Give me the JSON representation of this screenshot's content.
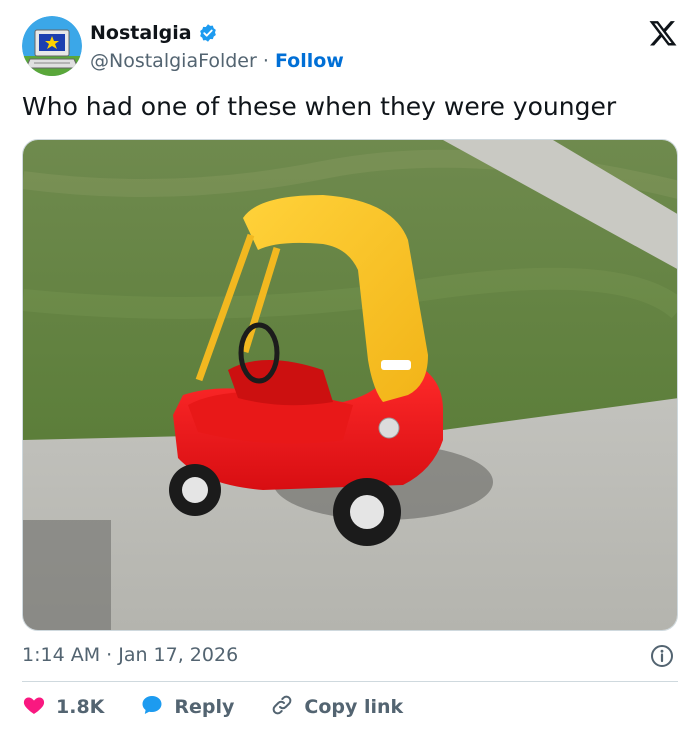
{
  "author": {
    "display_name": "Nostalgia",
    "handle": "@NostalgiaFolder",
    "separator": "·",
    "follow_label": "Follow"
  },
  "tweet": {
    "text": "Who had one of these when they were younger",
    "timestamp": "1:14 AM · Jan 17, 2026"
  },
  "actions": {
    "like_count": "1.8K",
    "reply_label": "Reply",
    "copy_link_label": "Copy link"
  },
  "icons": {
    "verified": "verified-badge-icon",
    "x_logo": "x-logo-icon",
    "info": "info-icon",
    "like": "heart-icon",
    "reply": "speech-bubble-icon",
    "copy_link": "link-icon"
  },
  "colors": {
    "text_primary": "#0f1419",
    "text_secondary": "#536471",
    "link_blue": "#006fd6",
    "verified_blue": "#1d9bf0",
    "like_red": "#f91880",
    "divider": "#cfd9de"
  }
}
